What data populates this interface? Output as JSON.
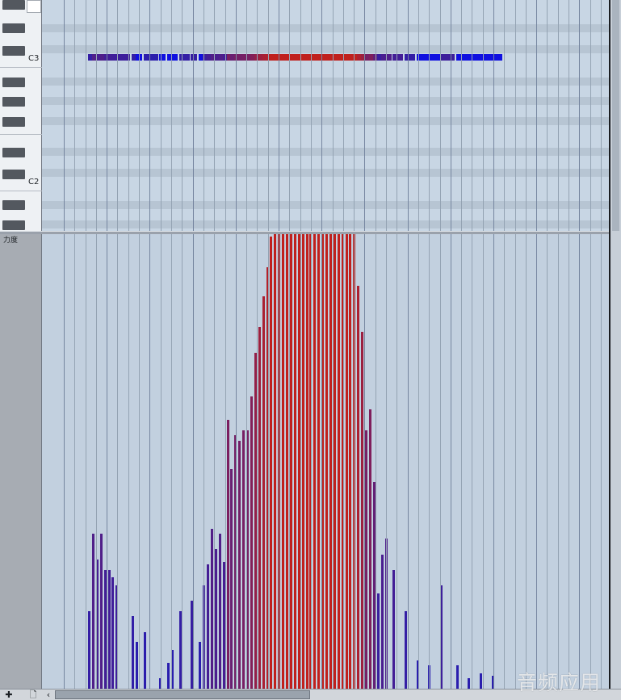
{
  "piano_roll": {
    "octave_labels": [
      "C3",
      "C2"
    ],
    "velocity_lane_label": "力度",
    "colors": {
      "low_velocity": "#2a1eae",
      "high_velocity": "#c0201d",
      "note_blue": "#1010e0"
    },
    "notes": [
      {
        "start": 0,
        "dur": 2,
        "v": 30
      },
      {
        "start": 1,
        "dur": 2,
        "v": 60
      },
      {
        "start": 2,
        "dur": 2,
        "v": 50
      },
      {
        "start": 3,
        "dur": 2,
        "v": 60
      },
      {
        "start": 4,
        "dur": 2,
        "v": 46
      },
      {
        "start": 5,
        "dur": 2,
        "v": 46
      },
      {
        "start": 6,
        "dur": 2,
        "v": 43
      },
      {
        "start": 7,
        "dur": 4,
        "v": 40
      },
      {
        "start": 11,
        "dur": 2,
        "v": 28
      },
      {
        "start": 12,
        "dur": 2,
        "v": 18
      },
      {
        "start": 14,
        "dur": 4,
        "v": 22
      },
      {
        "start": 18,
        "dur": 2,
        "v": 4
      },
      {
        "start": 20,
        "dur": 3,
        "v": 10
      },
      {
        "start": 21,
        "dur": 2,
        "v": 15
      },
      {
        "start": 23,
        "dur": 3,
        "v": 30
      },
      {
        "start": 26,
        "dur": 2,
        "v": 34
      },
      {
        "start": 28,
        "dur": 2,
        "v": 18
      },
      {
        "start": 29,
        "dur": 2,
        "v": 40
      },
      {
        "start": 30,
        "dur": 2,
        "v": 48
      },
      {
        "start": 31,
        "dur": 2,
        "v": 62
      },
      {
        "start": 32,
        "dur": 2,
        "v": 54
      },
      {
        "start": 33,
        "dur": 2,
        "v": 60
      },
      {
        "start": 34,
        "dur": 2,
        "v": 49
      },
      {
        "start": 35,
        "dur": 2,
        "v": 104
      },
      {
        "start": 36,
        "dur": 2,
        "v": 85
      },
      {
        "start": 37,
        "dur": 2,
        "v": 98
      },
      {
        "start": 38,
        "dur": 2,
        "v": 96
      },
      {
        "start": 39,
        "dur": 2,
        "v": 100
      },
      {
        "start": 40,
        "dur": 2,
        "v": 100
      },
      {
        "start": 41,
        "dur": 2,
        "v": 113
      },
      {
        "start": 42,
        "dur": 2,
        "v": 130
      },
      {
        "start": 43,
        "dur": 2,
        "v": 140
      },
      {
        "start": 44,
        "dur": 2,
        "v": 152
      },
      {
        "start": 45,
        "dur": 2,
        "v": 163
      },
      {
        "start": 46,
        "dur": 2,
        "v": 175
      },
      {
        "start": 47,
        "dur": 2,
        "v": 176
      },
      {
        "start": 48,
        "dur": 2,
        "v": 176
      },
      {
        "start": 49,
        "dur": 2,
        "v": 176
      },
      {
        "start": 50,
        "dur": 2,
        "v": 176
      },
      {
        "start": 51,
        "dur": 2,
        "v": 176
      },
      {
        "start": 52,
        "dur": 2,
        "v": 176
      },
      {
        "start": 53,
        "dur": 2,
        "v": 176
      },
      {
        "start": 54,
        "dur": 2,
        "v": 176
      },
      {
        "start": 55,
        "dur": 2,
        "v": 176
      },
      {
        "start": 56,
        "dur": 2,
        "v": 176
      },
      {
        "start": 57,
        "dur": 2,
        "v": 176
      },
      {
        "start": 58,
        "dur": 2,
        "v": 176
      },
      {
        "start": 59,
        "dur": 2,
        "v": 176
      },
      {
        "start": 60,
        "dur": 2,
        "v": 176
      },
      {
        "start": 61,
        "dur": 2,
        "v": 176
      },
      {
        "start": 62,
        "dur": 2,
        "v": 176
      },
      {
        "start": 63,
        "dur": 2,
        "v": 176
      },
      {
        "start": 64,
        "dur": 2,
        "v": 176
      },
      {
        "start": 65,
        "dur": 2,
        "v": 176
      },
      {
        "start": 66,
        "dur": 2,
        "v": 176
      },
      {
        "start": 67,
        "dur": 2,
        "v": 176
      },
      {
        "start": 68,
        "dur": 2,
        "v": 156
      },
      {
        "start": 69,
        "dur": 2,
        "v": 138
      },
      {
        "start": 70,
        "dur": 2,
        "v": 100
      },
      {
        "start": 71,
        "dur": 2,
        "v": 108
      },
      {
        "start": 72,
        "dur": 2,
        "v": 80
      },
      {
        "start": 73,
        "dur": 2,
        "v": 37
      },
      {
        "start": 74,
        "dur": 2,
        "v": 52
      },
      {
        "start": 75,
        "dur": 2,
        "v": 58
      },
      {
        "start": 77,
        "dur": 3,
        "v": 46
      },
      {
        "start": 80,
        "dur": 3,
        "v": 30
      },
      {
        "start": 83,
        "dur": 4,
        "v": 11
      },
      {
        "start": 86,
        "dur": 4,
        "v": 9
      },
      {
        "start": 89,
        "dur": 4,
        "v": 40
      },
      {
        "start": 93,
        "dur": 4,
        "v": 9
      },
      {
        "start": 96,
        "dur": 4,
        "v": 4
      },
      {
        "start": 99,
        "dur": 4,
        "v": 6
      },
      {
        "start": 102,
        "dur": 3,
        "v": 5
      }
    ]
  },
  "toolbar": {
    "add_icon": "plus-icon",
    "clip_icon": "page-icon",
    "scroll_left_icon": "chevron-left-icon"
  },
  "watermark": "音频应用"
}
